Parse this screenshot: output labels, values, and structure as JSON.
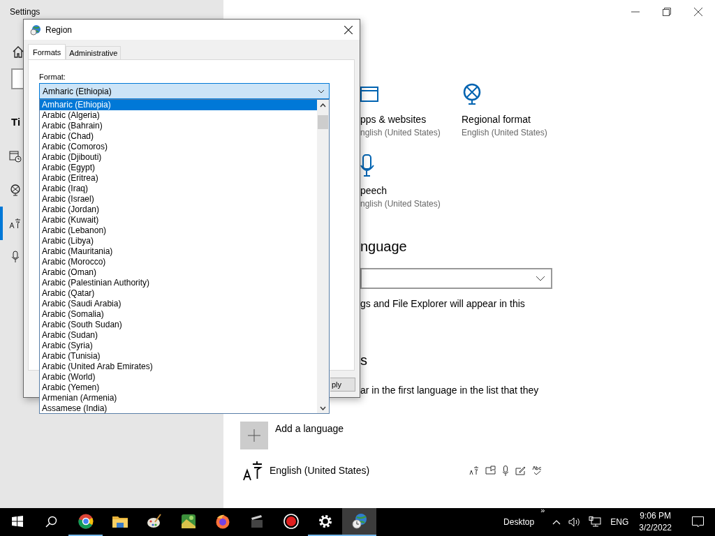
{
  "settings": {
    "title": "Settings",
    "heading": "Ti",
    "sidebar": [
      {
        "kind": "calendar",
        "selected": false
      },
      {
        "kind": "globe",
        "selected": false
      },
      {
        "kind": "language",
        "selected": true
      },
      {
        "kind": "mic",
        "selected": false
      }
    ],
    "cards": [
      {
        "kind": "window",
        "title": "pps & websites",
        "value": "nglish (United States)"
      },
      {
        "kind": "globe",
        "title": "Regional format",
        "value": "English (United States)"
      },
      {
        "kind": "mic",
        "title": "peech",
        "value": "nglish (United States)"
      }
    ],
    "section_heading": "nguage",
    "display_note": "gs and File Explorer will appear in this",
    "section_heading_2": "s",
    "preferred_note": "ar in the first language in the list that they",
    "add_language": "Add a language",
    "language": "English (United States)"
  },
  "dialog": {
    "title": "Region",
    "tabs": [
      {
        "label": "Formats",
        "selected": true
      },
      {
        "label": "Administrative",
        "selected": false
      }
    ],
    "format_label": "Format:",
    "format_value": "Amharic (Ethiopia)",
    "options": [
      {
        "label": "Amharic (Ethiopia)",
        "selected": true
      },
      {
        "label": "Arabic (Algeria)",
        "selected": false
      },
      {
        "label": "Arabic (Bahrain)",
        "selected": false
      },
      {
        "label": "Arabic (Chad)",
        "selected": false
      },
      {
        "label": "Arabic (Comoros)",
        "selected": false
      },
      {
        "label": "Arabic (Djibouti)",
        "selected": false
      },
      {
        "label": "Arabic (Egypt)",
        "selected": false
      },
      {
        "label": "Arabic (Eritrea)",
        "selected": false
      },
      {
        "label": "Arabic (Iraq)",
        "selected": false
      },
      {
        "label": "Arabic (Israel)",
        "selected": false
      },
      {
        "label": "Arabic (Jordan)",
        "selected": false
      },
      {
        "label": "Arabic (Kuwait)",
        "selected": false
      },
      {
        "label": "Arabic (Lebanon)",
        "selected": false
      },
      {
        "label": "Arabic (Libya)",
        "selected": false
      },
      {
        "label": "Arabic (Mauritania)",
        "selected": false
      },
      {
        "label": "Arabic (Morocco)",
        "selected": false
      },
      {
        "label": "Arabic (Oman)",
        "selected": false
      },
      {
        "label": "Arabic (Palestinian Authority)",
        "selected": false
      },
      {
        "label": "Arabic (Qatar)",
        "selected": false
      },
      {
        "label": "Arabic (Saudi Arabia)",
        "selected": false
      },
      {
        "label": "Arabic (Somalia)",
        "selected": false
      },
      {
        "label": "Arabic (South Sudan)",
        "selected": false
      },
      {
        "label": "Arabic (Sudan)",
        "selected": false
      },
      {
        "label": "Arabic (Syria)",
        "selected": false
      },
      {
        "label": "Arabic (Tunisia)",
        "selected": false
      },
      {
        "label": "Arabic (United Arab Emirates)",
        "selected": false
      },
      {
        "label": "Arabic (World)",
        "selected": false
      },
      {
        "label": "Arabic (Yemen)",
        "selected": false
      },
      {
        "label": "Armenian (Armenia)",
        "selected": false
      },
      {
        "label": "Assamese (India)",
        "selected": false
      }
    ],
    "apply_button": "ply"
  },
  "taskbar": {
    "apps": [
      {
        "kind": "start",
        "running": false,
        "selected": false
      },
      {
        "kind": "search",
        "running": false,
        "selected": false
      },
      {
        "kind": "chrome",
        "running": true,
        "selected": false
      },
      {
        "kind": "folder",
        "running": false,
        "selected": false
      },
      {
        "kind": "paint",
        "running": false,
        "selected": false
      },
      {
        "kind": "photo",
        "running": false,
        "selected": false
      },
      {
        "kind": "firefox",
        "running": false,
        "selected": false
      },
      {
        "kind": "clapper",
        "running": false,
        "selected": false
      },
      {
        "kind": "record",
        "running": false,
        "selected": false
      },
      {
        "kind": "gear",
        "running": true,
        "selected": false
      },
      {
        "kind": "region",
        "running": true,
        "selected": true
      }
    ],
    "desktop": "Desktop",
    "more": "»",
    "input": "ENG",
    "time": "9:06 PM",
    "date": "3/2/2022"
  }
}
